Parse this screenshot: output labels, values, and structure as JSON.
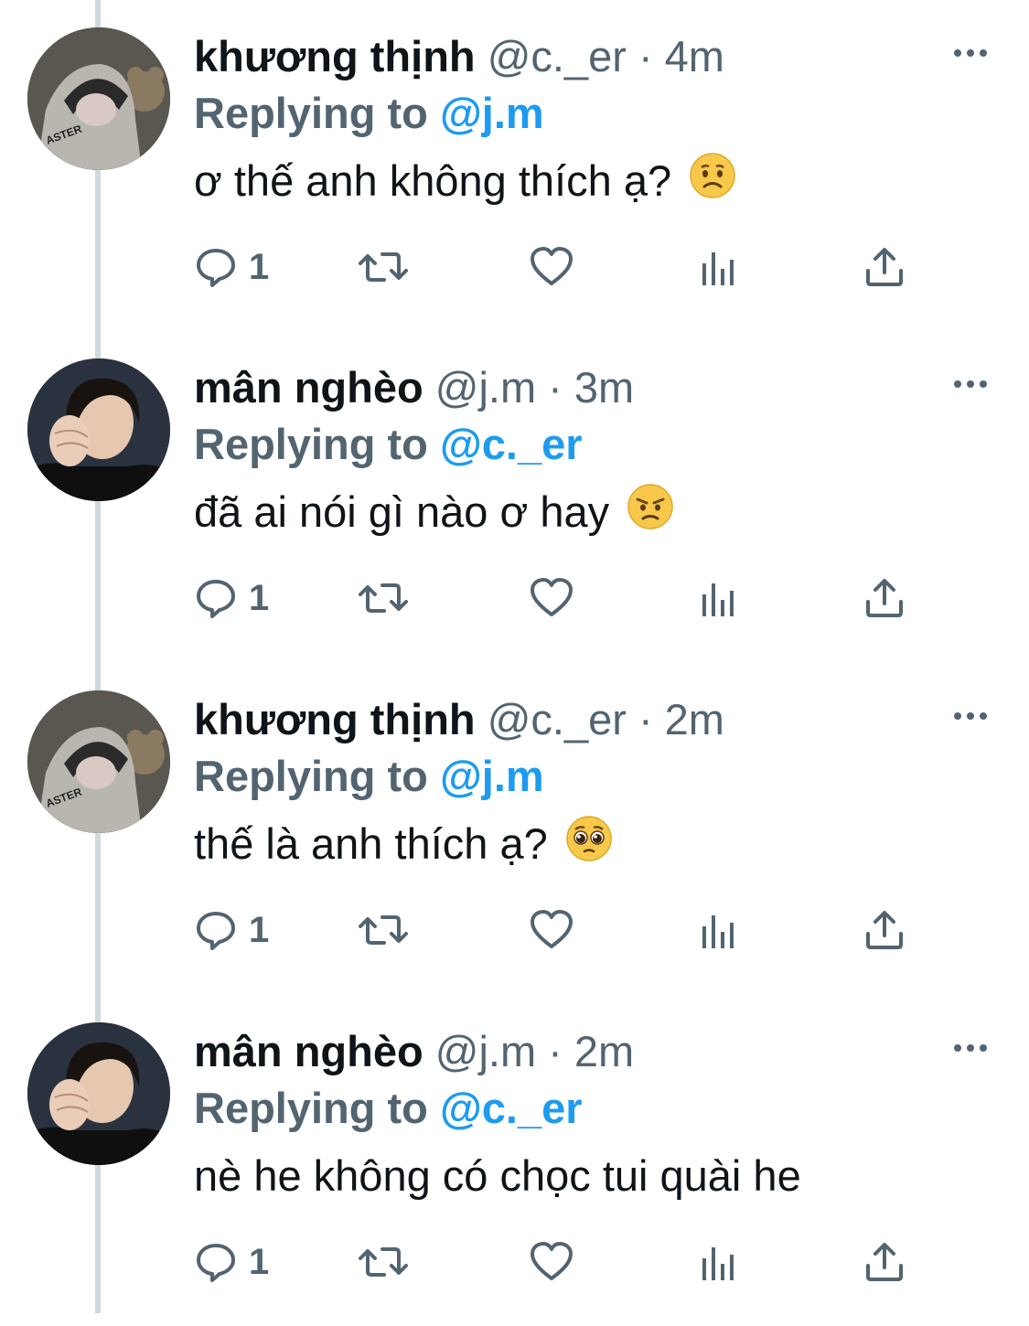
{
  "thread": [
    {
      "name": "khương thịnh",
      "handle": "@c._er",
      "sep": " · ",
      "time": "4m",
      "replying_prefix": "Replying to ",
      "replying_handle": "@j.m",
      "text": "ơ thế anh không thích ạ?",
      "emoji": "worried-face-icon",
      "reply_count": "1",
      "avatar": "avatar-hoodie"
    },
    {
      "name": "mân nghèo",
      "handle": "@j.m",
      "sep": " · ",
      "time": "3m",
      "replying_prefix": "Replying to ",
      "replying_handle": "@c._er",
      "text": "đã ai nói gì nào ơ hay",
      "emoji": "angry-face-icon",
      "reply_count": "1",
      "avatar": "avatar-portrait"
    },
    {
      "name": "khương thịnh",
      "handle": "@c._er",
      "sep": " · ",
      "time": "2m",
      "replying_prefix": "Replying to ",
      "replying_handle": "@j.m",
      "text": "thế là anh thích ạ?",
      "emoji": "pleading-face-icon",
      "reply_count": "1",
      "avatar": "avatar-hoodie"
    },
    {
      "name": "mân nghèo",
      "handle": "@j.m",
      "sep": " · ",
      "time": "2m",
      "replying_prefix": "Replying to ",
      "replying_handle": "@c._er",
      "text": "nè he không có chọc tui quài he",
      "emoji": "",
      "reply_count": "1",
      "avatar": "avatar-portrait"
    }
  ],
  "colors": {
    "text": "#0f1419",
    "secondary": "#536471",
    "link": "#1d9bf0",
    "thread_line": "#cfd9de"
  }
}
